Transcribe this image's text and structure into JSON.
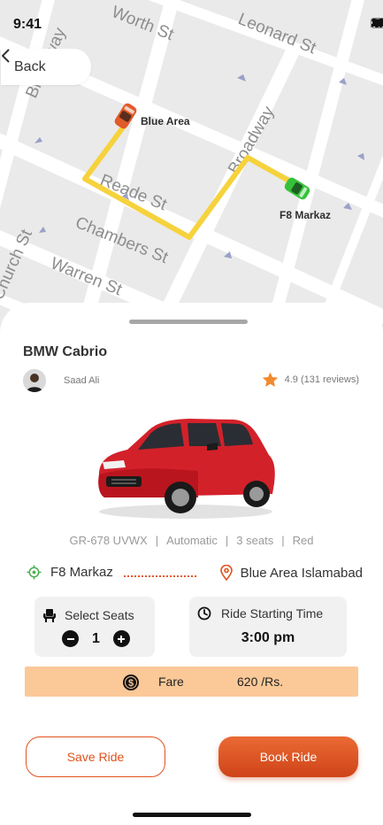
{
  "status_bar": {
    "time": "9:41"
  },
  "nav": {
    "back_label": "Back"
  },
  "map": {
    "streets": [
      "Worth St",
      "Leonard St",
      "Broadway",
      "Broadway",
      "Reade St",
      "Chambers St",
      "Warren St",
      "Church St"
    ],
    "pickup_label": "Blue Area",
    "dropoff_label": "F8 Markaz",
    "colors": {
      "route": "#f6d23c",
      "pickup_car": "#e05a2a",
      "dropoff_car": "#35c23a"
    }
  },
  "ride": {
    "car_name": "BMW Cabrio",
    "owner_name": "Saad Ali",
    "rating": "4.9 (131 reviews)",
    "specs": [
      "GR-678 UVWX",
      "Automatic",
      "3 seats",
      "Red"
    ],
    "from": "F8 Markaz",
    "to": "Blue Area Islamabad"
  },
  "seats": {
    "title": "Select Seats",
    "count": "1"
  },
  "start_time": {
    "title": "Ride Starting Time",
    "value": "3:00 pm"
  },
  "fare": {
    "label": "Fare",
    "value": "620 /Rs."
  },
  "actions": {
    "save_label": "Save Ride",
    "book_label": "Book Ride"
  },
  "theme": {
    "accent": "#e0531d",
    "fare_bg": "#fbc898",
    "card_bg": "#f1f1f1"
  }
}
